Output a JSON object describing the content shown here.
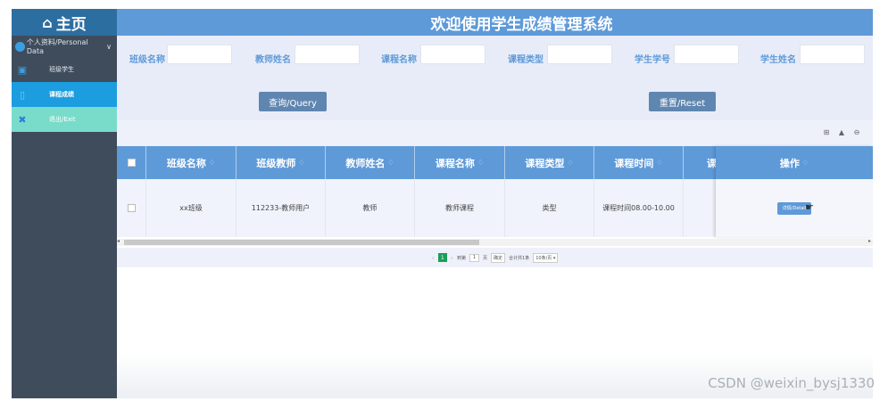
{
  "sidebar": {
    "home": "主页",
    "personal": "个人资料/Personal Data",
    "items": [
      {
        "label": "班级学生"
      },
      {
        "label": "课程成绩"
      },
      {
        "label": "退出/Exit"
      }
    ]
  },
  "header": {
    "title": "欢迎使用学生成绩管理系统"
  },
  "filters": {
    "fields": [
      {
        "label": "班级名称",
        "value": ""
      },
      {
        "label": "教师姓名",
        "value": ""
      },
      {
        "label": "课程名称",
        "value": ""
      },
      {
        "label": "课程类型",
        "value": ""
      },
      {
        "label": "学生学号",
        "value": ""
      },
      {
        "label": "学生姓名",
        "value": ""
      }
    ],
    "query_label": "查询/Query",
    "reset_label": "重置/Reset"
  },
  "table": {
    "columns": [
      "班级名称",
      "班级教师",
      "教师姓名",
      "课程名称",
      "课程类型",
      "课程时间",
      "课"
    ],
    "rows": [
      [
        "xx班级",
        "112233-教师用户",
        "教师",
        "教师课程",
        "类型",
        "课程时间08.00-10.00",
        ""
      ]
    ],
    "operation_header": "操作",
    "detail_button": "详情/Detail"
  },
  "pager": {
    "current_page": "1",
    "goto_label": "到第",
    "goto_value": "1",
    "page_unit": "页",
    "confirm": "确定",
    "total": "合计共1条",
    "page_size": "10条/页"
  },
  "watermark": "CSDN @weixin_bysj1330",
  "colors": {
    "header": "#5e9ad8",
    "sidebar": "#3f4c5c",
    "active": "#1b9de0",
    "exit": "#79dccb"
  }
}
